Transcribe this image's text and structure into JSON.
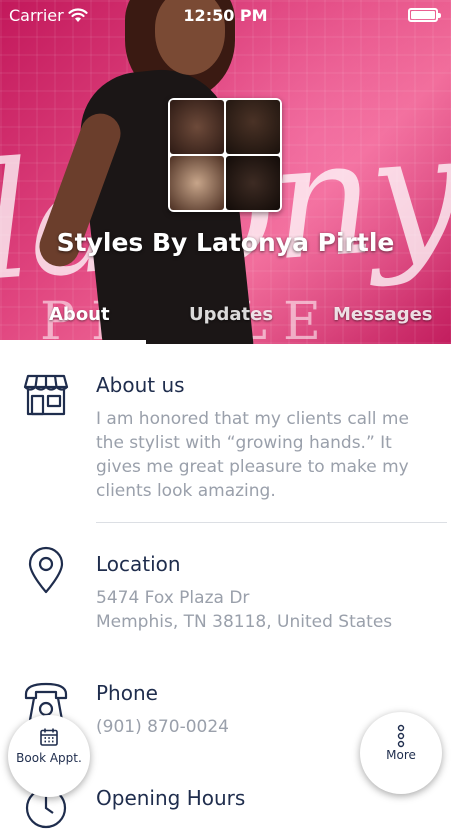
{
  "status_bar": {
    "carrier": "Carrier",
    "time": "12:50 PM"
  },
  "header": {
    "business_name": "Styles By Latonya Pirtle",
    "banner_script_text": "latonya",
    "banner_subtext": "PIRTLE"
  },
  "tabs": [
    {
      "label": "About",
      "active": true
    },
    {
      "label": "Updates",
      "active": false
    },
    {
      "label": "Messages",
      "active": false
    }
  ],
  "sections": {
    "about": {
      "title": "About us",
      "body": "I am honored that my clients call me the stylist with “growing hands.”  It gives me great pleasure to make my clients look amazing.",
      "icon": "storefront-icon"
    },
    "location": {
      "title": "Location",
      "line1": "5474 Fox Plaza Dr",
      "line2": "Memphis, TN 38118, United States",
      "icon": "map-pin-icon"
    },
    "phone": {
      "title": "Phone",
      "number": "(901) 870-0024",
      "icon": "telephone-icon"
    },
    "hours": {
      "title": "Opening Hours",
      "icon": "clock-icon"
    }
  },
  "fabs": {
    "book_label": "Book Appt.",
    "more_label": "More"
  },
  "colors": {
    "text_primary": "#1f2d4d",
    "text_secondary": "#9aa0ab",
    "header_pink": "#e0457f"
  }
}
